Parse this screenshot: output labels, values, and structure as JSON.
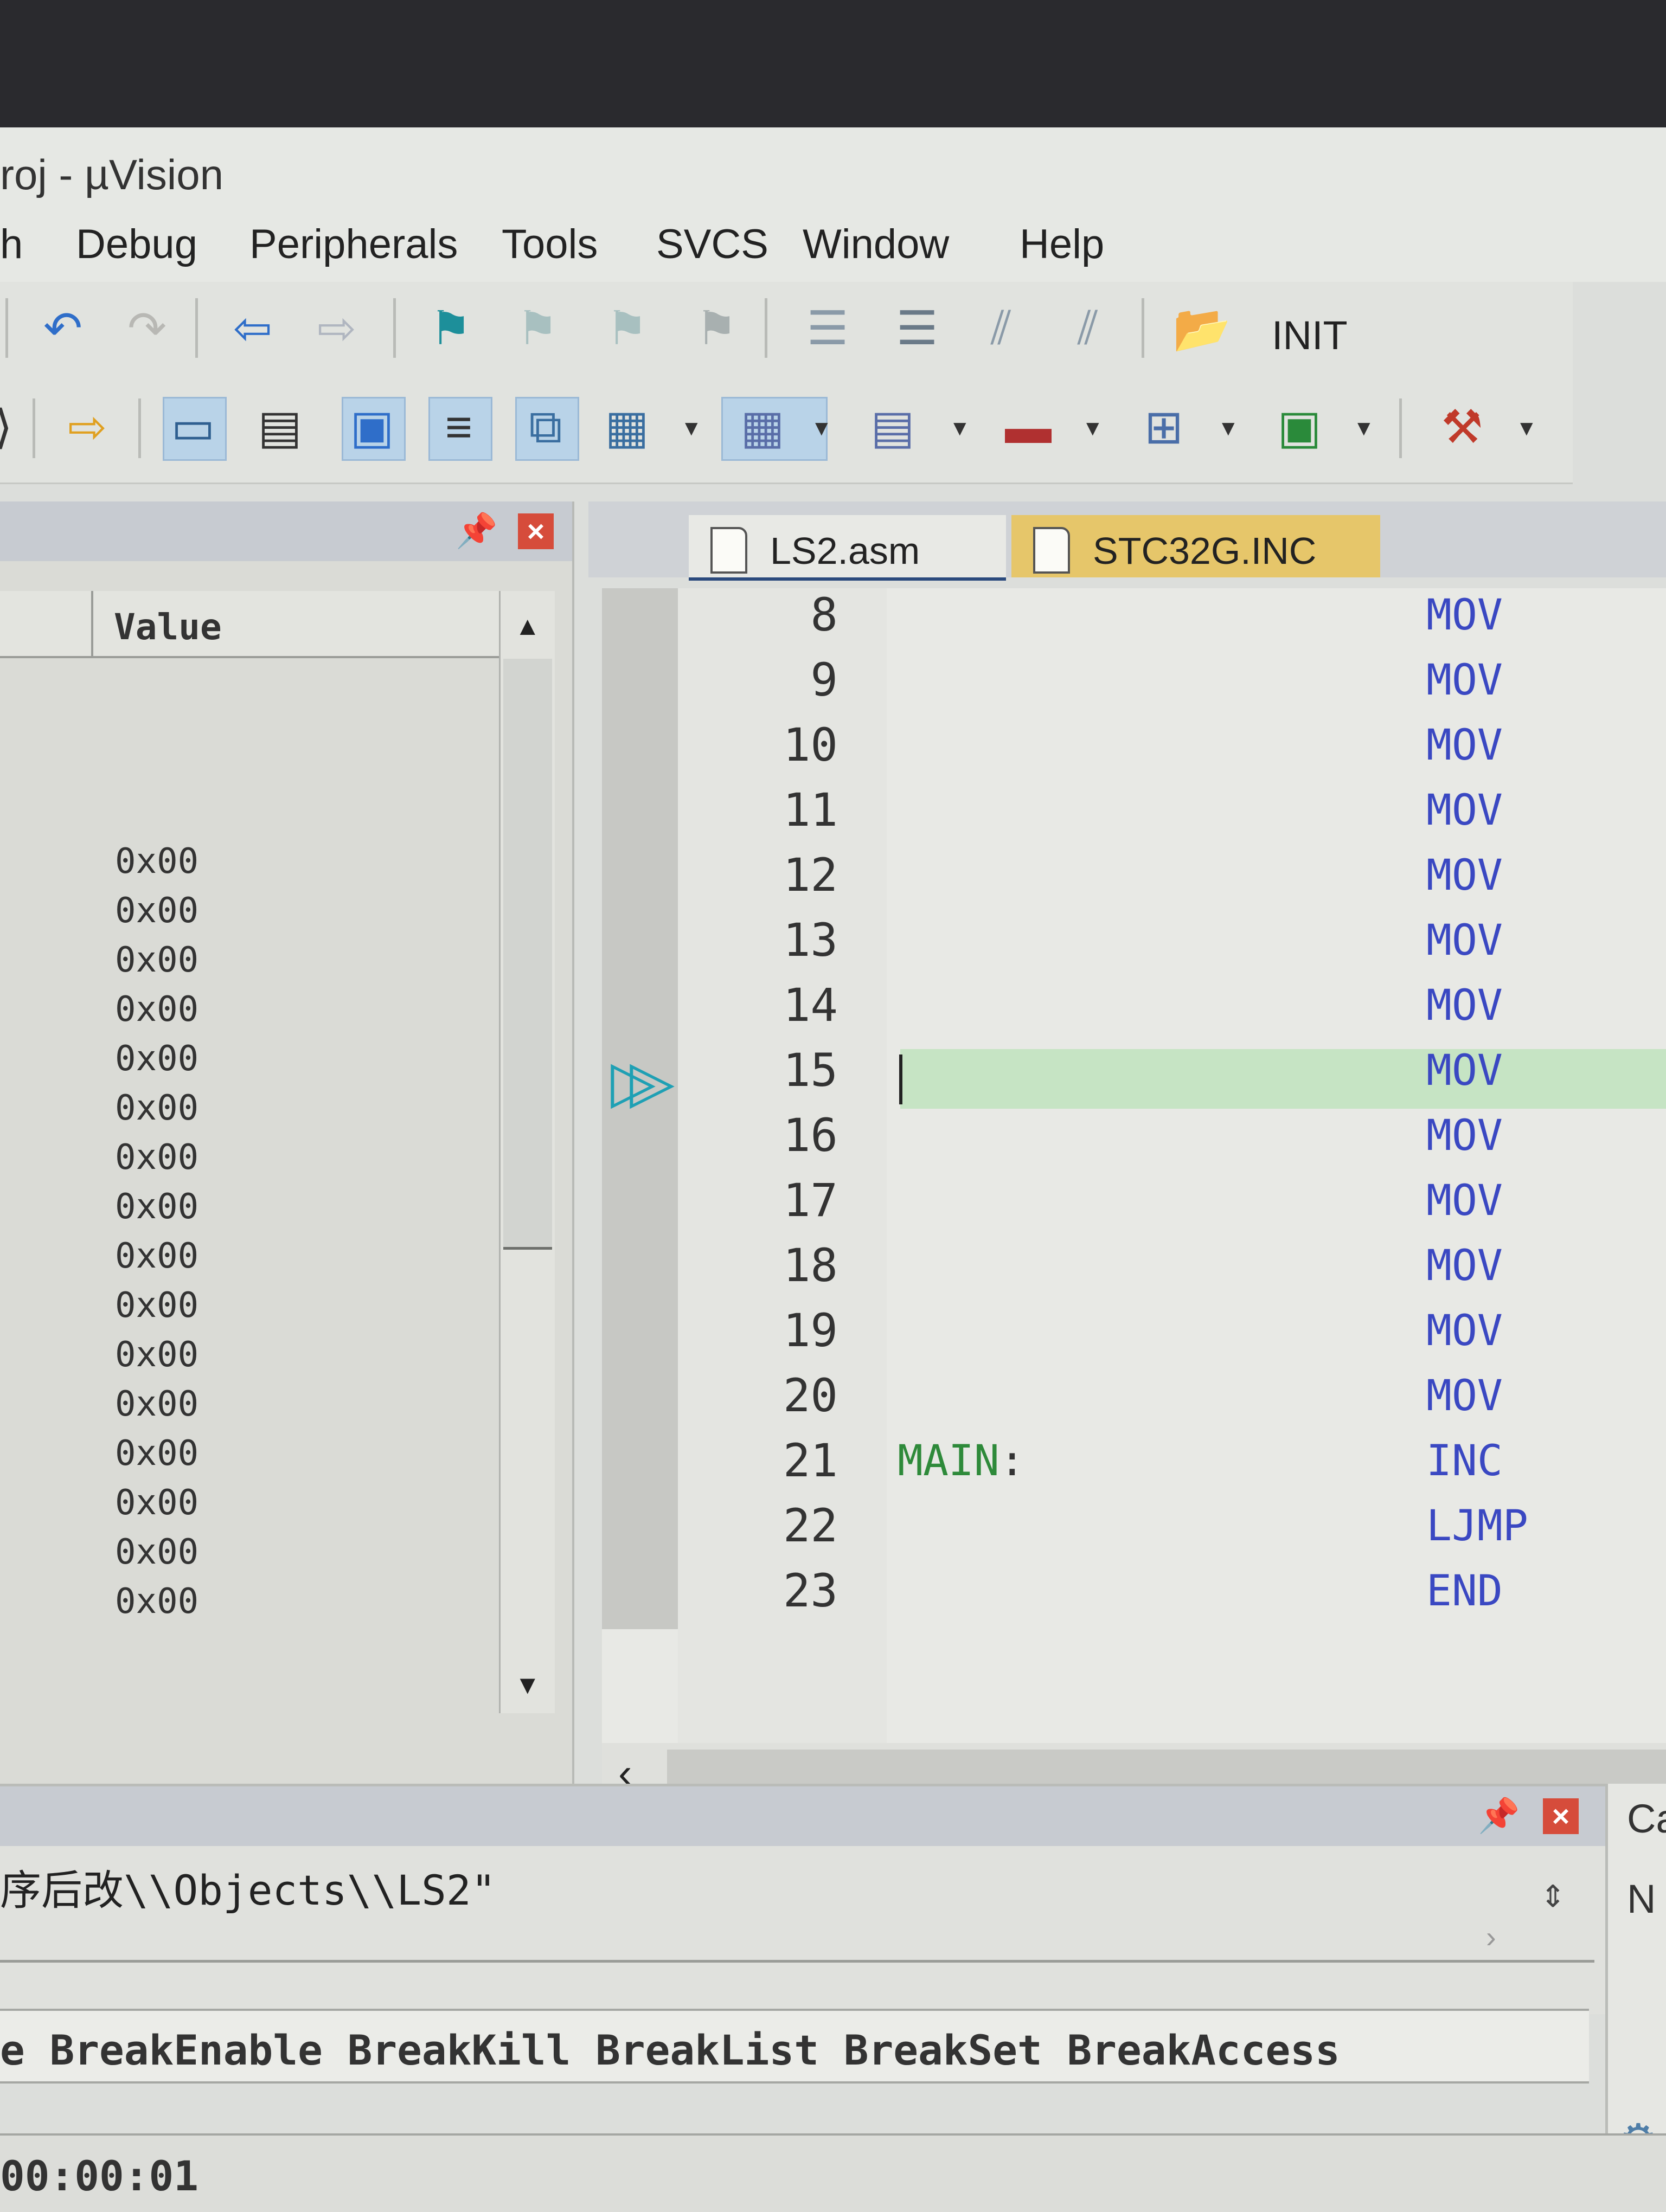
{
  "window": {
    "title": "roj - µVision"
  },
  "menu": [
    "h",
    "Debug",
    "Peripherals",
    "Tools",
    "SVCS",
    "Window",
    "Help"
  ],
  "toolbar": {
    "init_label": "INIT"
  },
  "watch_panel": {
    "column_header": "Value",
    "values": [
      "0x00",
      "0x00",
      "0x00",
      "0x00",
      "0x00",
      "0x00",
      "0x00",
      "0x00",
      "0x00",
      "0x00",
      "0x00",
      "0x00",
      "0x00",
      "0x00",
      "0x00",
      "0x00"
    ]
  },
  "editor": {
    "tabs": [
      {
        "label": "LS2.asm",
        "active": true
      },
      {
        "label": "STC32G.INC",
        "active": false
      }
    ],
    "current_line": "15",
    "lines": [
      {
        "num": "8",
        "label": "",
        "instr": "MOV"
      },
      {
        "num": "9",
        "label": "",
        "instr": "MOV"
      },
      {
        "num": "10",
        "label": "",
        "instr": "MOV"
      },
      {
        "num": "11",
        "label": "",
        "instr": "MOV"
      },
      {
        "num": "12",
        "label": "",
        "instr": "MOV"
      },
      {
        "num": "13",
        "label": "",
        "instr": "MOV"
      },
      {
        "num": "14",
        "label": "",
        "instr": "MOV"
      },
      {
        "num": "15",
        "label": "",
        "instr": "MOV"
      },
      {
        "num": "16",
        "label": "",
        "instr": "MOV"
      },
      {
        "num": "17",
        "label": "",
        "instr": "MOV"
      },
      {
        "num": "18",
        "label": "",
        "instr": "MOV"
      },
      {
        "num": "19",
        "label": "",
        "instr": "MOV"
      },
      {
        "num": "20",
        "label": "",
        "instr": "MOV"
      },
      {
        "num": "21",
        "label": "MAIN",
        "instr": "INC"
      },
      {
        "num": "22",
        "label": "",
        "instr": "LJMP"
      },
      {
        "num": "23",
        "label": "",
        "instr": "END"
      }
    ]
  },
  "build_output": {
    "text": "序后改\\\\Objects\\\\LS2\""
  },
  "command": {
    "text": "e BreakEnable BreakKill BreakList BreakSet BreakAccess"
  },
  "right_panel": {
    "label_top": "Ca",
    "label_mid": "N"
  },
  "status": {
    "time": "00:00:01"
  },
  "colors": {
    "label_green": "#2e8a3a",
    "instr_blue": "#3a48c2",
    "current_line_bg": "#c6e4c4",
    "tab_inactive": "#e6c66a",
    "close_red": "#d64c3b"
  }
}
